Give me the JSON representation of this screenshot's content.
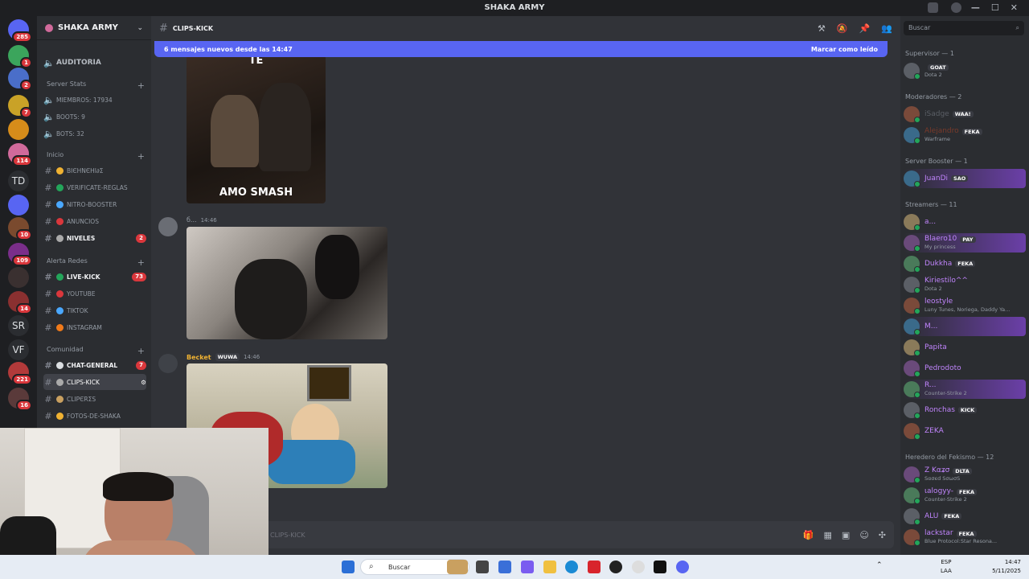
{
  "window": {
    "title": "SHAKA ARMY"
  },
  "guilds": [
    {
      "badge": "285",
      "color": "#5865f2",
      "label": ""
    },
    {
      "badge": "1",
      "color": "#3ba55c",
      "label": ""
    },
    {
      "badge": "2",
      "color": "#4a6ec9",
      "label": ""
    },
    {
      "badge": "7",
      "color": "#c9a227",
      "label": ""
    },
    {
      "badge": "",
      "color": "#d68c1a",
      "label": ""
    },
    {
      "badge": "114",
      "color": "#d16a9b",
      "label": ""
    },
    {
      "badge": "",
      "color": "#2b2d31",
      "label": "TD"
    },
    {
      "badge": "",
      "color": "#5865f2",
      "label": ""
    },
    {
      "badge": "10",
      "color": "#7a4a2e",
      "label": ""
    },
    {
      "badge": "109",
      "color": "#7a2e8a",
      "label": ""
    },
    {
      "badge": "",
      "color": "#3a3030",
      "label": ""
    },
    {
      "badge": "14",
      "color": "#8a3030",
      "label": ""
    },
    {
      "badge": "",
      "color": "#2b2d31",
      "label": "SR"
    },
    {
      "badge": "",
      "color": "#2b2d31",
      "label": "VF"
    },
    {
      "badge": "221",
      "color": "#b23a3a",
      "label": ""
    },
    {
      "badge": "16",
      "color": "#5a3a3a",
      "label": ""
    }
  ],
  "server": {
    "name": "SHAKA ARMY",
    "top_channel": "AUDITORIA",
    "categories": {
      "stats": "Server Stats",
      "inicio": "Inicio",
      "alertas": "Alerta Redes",
      "comunidad": "Comunidad"
    },
    "stats": [
      "MIEMBROS: 17934",
      "BOOTS: 9",
      "BOTS: 32"
    ],
    "inicio_channels": [
      {
        "label": "вιєηνєηι∂σ",
        "badge": ""
      },
      {
        "label": "VERIFICATE-REGLAS",
        "badge": ""
      },
      {
        "label": "NITRO-BOOSTER",
        "badge": ""
      },
      {
        "label": "ANUNCIOS",
        "badge": ""
      },
      {
        "label": "NIVELES",
        "badge": "2"
      }
    ],
    "alert_channels": [
      {
        "label": "LIVE-KICK",
        "badge": "73"
      },
      {
        "label": "YOUTUBE",
        "badge": ""
      },
      {
        "label": "TIKTOK",
        "badge": ""
      },
      {
        "label": "INSTAGRAM",
        "badge": ""
      }
    ],
    "community_channels": [
      {
        "label": "CHAT-GENERAL",
        "badge": "7"
      },
      {
        "label": "CLIPS-KICK",
        "badge": ""
      },
      {
        "label": "clipєrσs",
        "badge": ""
      },
      {
        "label": "FOTOS-DE-SHAKA",
        "badge": ""
      }
    ]
  },
  "channel": {
    "name": "CLIPS-KICK"
  },
  "banner": {
    "text": "6 mensajes nuevos desde las 14:47",
    "action": "Marcar como leído"
  },
  "messages": [
    {
      "caption_top": "TE",
      "caption_bottom": "AMO SMASH"
    },
    {
      "author": "б...",
      "time": "14:46"
    },
    {
      "author": "Becket",
      "tag": "WUWA",
      "time": "14:46"
    }
  ],
  "composer": {
    "placeholder": "CLIPS-KICK"
  },
  "members": {
    "search_placeholder": "Buscar",
    "groups": [
      {
        "title": "Supervisor — 1",
        "items": [
          {
            "name": "",
            "tag": "GOAT",
            "status": "Dota 2",
            "color": "#da373c"
          }
        ]
      },
      {
        "title": "Moderadores — 2",
        "items": [
          {
            "name": "iSadge",
            "tag": "WAA!",
            "status": "",
            "color": "#5b5f66"
          },
          {
            "name": "Alejandro",
            "tag": "FEKA",
            "status": "Warframe",
            "color": "#7a3a2a"
          }
        ]
      },
      {
        "title": "Server Booster — 1",
        "items": [
          {
            "name": "JuanDi",
            "tag": "SAO",
            "status": "",
            "color": "#c084fc"
          }
        ]
      },
      {
        "title": "Streamers — 11",
        "items": [
          {
            "name": "a...",
            "tag": "",
            "status": "",
            "color": "#c084fc"
          },
          {
            "name": "Blaero10",
            "tag": "PAY",
            "status": "My princess",
            "color": "#c084fc"
          },
          {
            "name": "Dukkha",
            "tag": "FEKA",
            "status": "",
            "color": "#c084fc"
          },
          {
            "name": "Kiriestilo^^",
            "tag": "",
            "status": "Dota 2",
            "color": "#c084fc"
          },
          {
            "name": "leostyle",
            "tag": "",
            "status": "Luny Tunes, Noriega, Daddy Ya...",
            "color": "#c084fc"
          },
          {
            "name": "M...",
            "tag": "",
            "status": "",
            "color": "#c084fc"
          },
          {
            "name": "Papita",
            "tag": "",
            "status": "",
            "color": "#c084fc"
          },
          {
            "name": "Pedrodoto",
            "tag": "",
            "status": "",
            "color": "#c084fc"
          },
          {
            "name": "R...",
            "tag": "",
            "status": "Counter-Strike 2",
            "color": "#c084fc"
          },
          {
            "name": "Ronchas",
            "tag": "KICK",
            "status": "",
            "color": "#c084fc"
          },
          {
            "name": "ZEKA",
            "tag": "",
            "status": "",
            "color": "#c084fc"
          }
        ]
      },
      {
        "title": "Heredero del Fekismo — 12",
        "items": [
          {
            "name": "Z Kαʑσ",
            "tag": "DLTA",
            "status": "Sασєd SσωσS",
            "color": "#c084fc"
          },
          {
            "name": "ιalogyy-",
            "tag": "FEKA",
            "status": "Counter-Strike 2",
            "color": "#c084fc"
          },
          {
            "name": "ALU",
            "tag": "FEKA",
            "status": "",
            "color": "#c084fc"
          },
          {
            "name": "lackstar",
            "tag": "FEKA",
            "status": "Blue Protocol:Star Resona...",
            "color": "#c084fc"
          }
        ]
      }
    ]
  },
  "taskbar": {
    "search": "Buscar",
    "lang1": "ESP",
    "lang2": "LAA",
    "time": "14:47",
    "date": "5/11/2025"
  },
  "colors": {
    "accent": "#5865f2",
    "bg": "#313338",
    "sidebar": "#2b2d31",
    "rail": "#1e1f22"
  }
}
